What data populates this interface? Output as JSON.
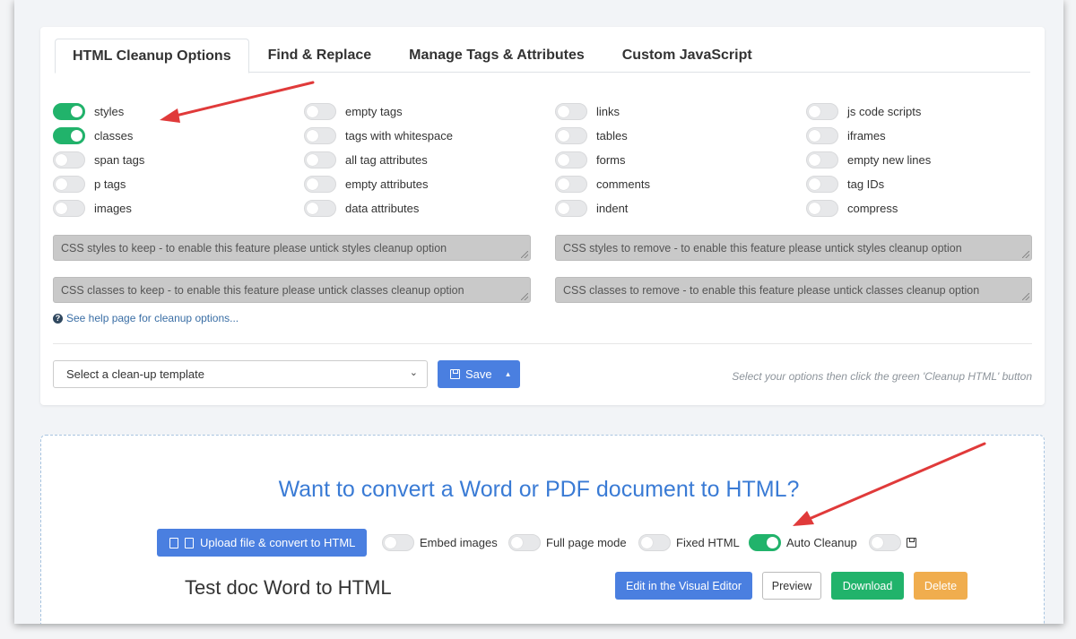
{
  "tabs": [
    {
      "label": "HTML Cleanup Options",
      "active": true
    },
    {
      "label": "Find & Replace",
      "active": false
    },
    {
      "label": "Manage Tags & Attributes",
      "active": false
    },
    {
      "label": "Custom JavaScript",
      "active": false
    }
  ],
  "options": {
    "col1": [
      {
        "label": "styles",
        "on": true
      },
      {
        "label": "classes",
        "on": true
      },
      {
        "label": "span tags",
        "on": false
      },
      {
        "label": "p tags",
        "on": false
      },
      {
        "label": "images",
        "on": false
      }
    ],
    "col2": [
      {
        "label": "empty tags",
        "on": false
      },
      {
        "label": "tags with whitespace",
        "on": false
      },
      {
        "label": "all tag attributes",
        "on": false
      },
      {
        "label": "empty attributes",
        "on": false
      },
      {
        "label": "data attributes",
        "on": false
      }
    ],
    "col3": [
      {
        "label": "links",
        "on": false
      },
      {
        "label": "tables",
        "on": false
      },
      {
        "label": "forms",
        "on": false
      },
      {
        "label": "comments",
        "on": false
      },
      {
        "label": "indent",
        "on": false
      }
    ],
    "col4": [
      {
        "label": "js code scripts",
        "on": false
      },
      {
        "label": "iframes",
        "on": false
      },
      {
        "label": "empty new lines",
        "on": false
      },
      {
        "label": "tag IDs",
        "on": false
      },
      {
        "label": "compress",
        "on": false
      }
    ]
  },
  "textareas": {
    "styles_keep": "CSS styles to keep - to enable this feature please untick styles cleanup option",
    "styles_remove": "CSS styles to remove - to enable this feature please untick styles cleanup option",
    "classes_keep": "CSS classes to keep - to enable this feature please untick classes cleanup option",
    "classes_remove": "CSS classes to remove - to enable this feature please untick classes cleanup option"
  },
  "help_link": "See help page for cleanup options...",
  "template_select": "Select a clean-up template",
  "save_label": "Save",
  "hint": "Select your options then click the green 'Cleanup HTML' button",
  "convert": {
    "title": "Want to convert a Word or PDF document to HTML?",
    "upload_label": "Upload file & convert to HTML",
    "embed_images": "Embed images",
    "full_page_mode": "Full page mode",
    "fixed_html": "Fixed HTML",
    "auto_cleanup": "Auto Cleanup",
    "doc_title": "Test doc Word to HTML",
    "edit_label": "Edit in the Visual Editor",
    "preview_label": "Preview",
    "download_label": "Download",
    "delete_label": "Delete"
  },
  "colors": {
    "accent_blue": "#4a7fe0",
    "toggle_on": "#21b36b",
    "arrow_red": "#e03a3a",
    "delete_orange": "#f0ad4e"
  }
}
